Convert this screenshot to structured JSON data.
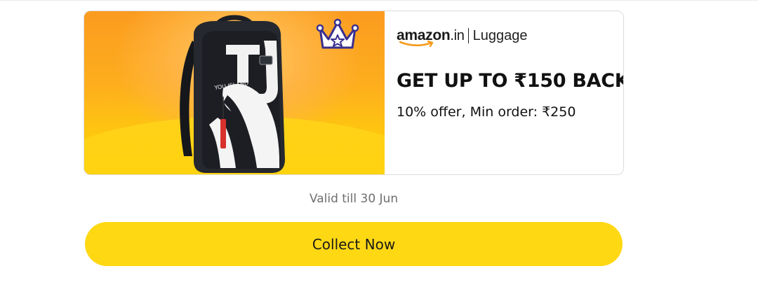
{
  "offer": {
    "brand": {
      "logo_text": "amazon",
      "logo_tld": ".in",
      "category": "Luggage"
    },
    "title": "GET UP TO ₹150 BACK",
    "terms": "10% offer, Min order: ₹250",
    "image": {
      "subject": "backpack",
      "badge_icon": "crown-icon",
      "backpack_print_text": "YOU ISLAND"
    }
  },
  "validity_text": "Valid till 30 Jun",
  "collect_button": {
    "label": "Collect Now"
  },
  "colors": {
    "button_yellow": "#ffd814",
    "banner_orange": "#fb9b20",
    "banner_yellow": "#ffd400",
    "logo_smile": "#f59a1b",
    "crown_purple": "#3a2f8f"
  }
}
